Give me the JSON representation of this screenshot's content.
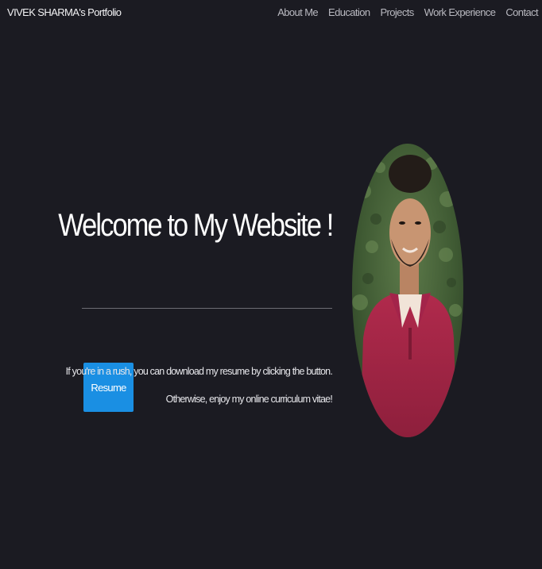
{
  "navbar": {
    "brand": "VIVEK SHARMA's Portfolio",
    "links": [
      "About Me",
      "Education",
      "Projects",
      "Work Experience",
      "Contact"
    ]
  },
  "hero": {
    "title": "Welcome to My Website !",
    "resume_button": "Resume",
    "rush_text": "If you're in a rush, you can download my resume by clicking the button.",
    "otherwise_text": "Otherwise, enjoy my online curriculum vitae!"
  },
  "colors": {
    "background": "#1b1b22",
    "accent": "#1a8fe3",
    "nav_text": "#b9b9c0"
  },
  "icons": {
    "profile": "profile-photo"
  }
}
